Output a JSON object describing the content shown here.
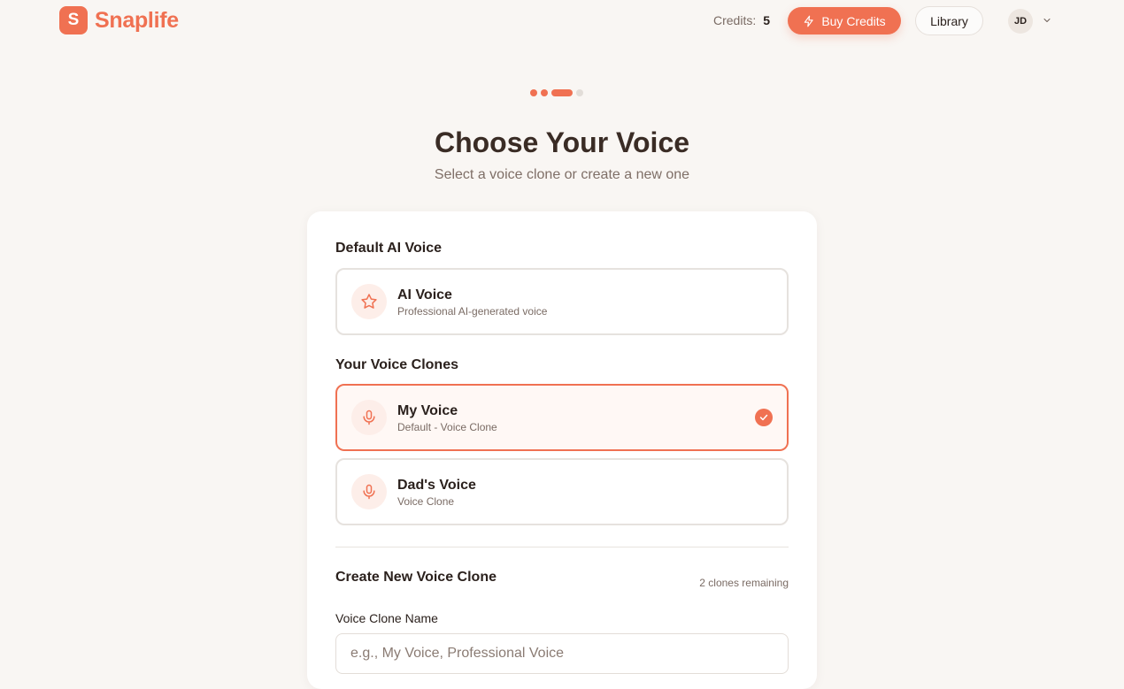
{
  "header": {
    "logo_letter": "S",
    "brand": "Snaplife",
    "credits_label": "Credits:",
    "credits_count": "5",
    "buy_label": "Buy Credits",
    "library_label": "Library",
    "avatar_initials": "JD"
  },
  "progress": {
    "total_steps": 4,
    "current_step": 3
  },
  "page": {
    "title": "Choose Your Voice",
    "subtitle": "Select a voice clone or create a new one"
  },
  "default_section": {
    "label": "Default AI Voice",
    "option": {
      "title": "AI Voice",
      "subtitle": "Professional AI-generated voice",
      "icon": "star-icon"
    }
  },
  "clones_section": {
    "label": "Your Voice Clones",
    "items": [
      {
        "title": "My Voice",
        "subtitle": "Default - Voice Clone",
        "icon": "microphone-icon",
        "selected": true
      },
      {
        "title": "Dad's Voice",
        "subtitle": "Voice Clone",
        "icon": "microphone-icon",
        "selected": false
      }
    ]
  },
  "create_section": {
    "label": "Create New Voice Clone",
    "remaining": "2 clones remaining",
    "name_label": "Voice Clone Name",
    "name_placeholder": "e.g., My Voice, Professional Voice",
    "name_value": ""
  },
  "colors": {
    "accent": "#f07152",
    "background": "#f9f6f3",
    "selected_bg": "#fff8f5"
  }
}
